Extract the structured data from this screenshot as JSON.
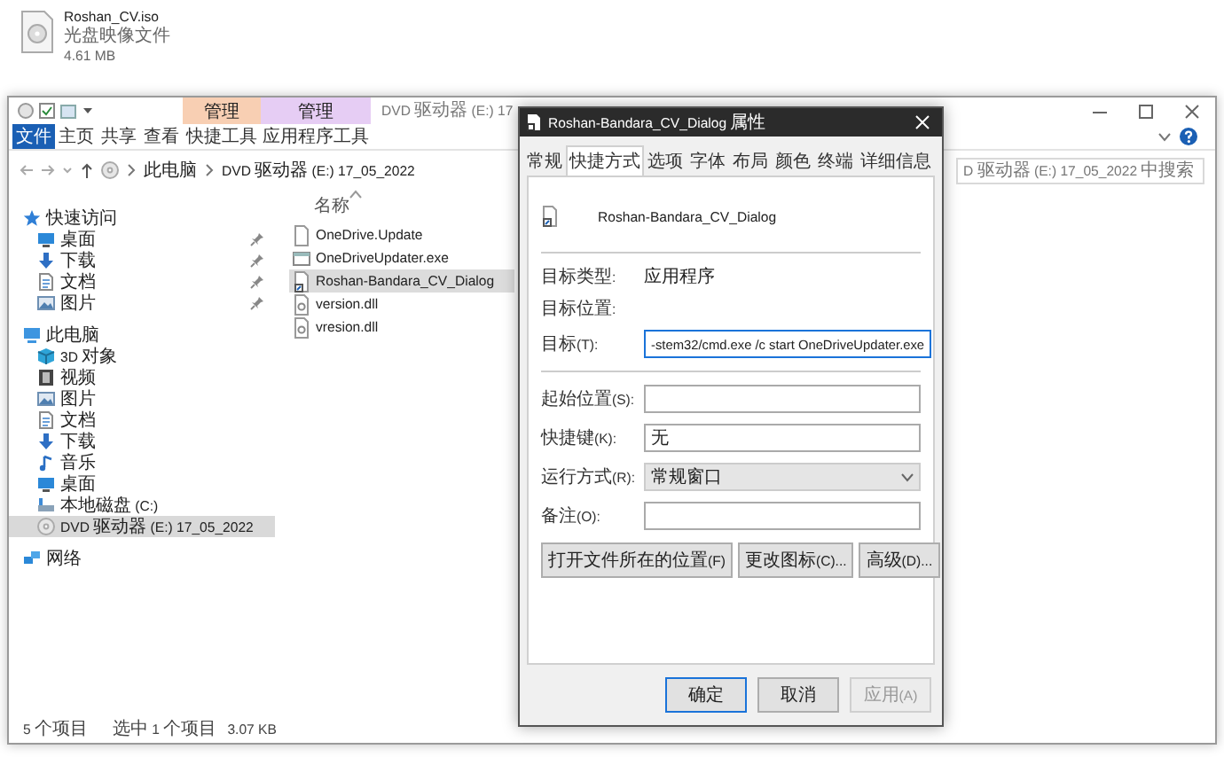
{
  "desktop_file": {
    "name": "Roshan_CV.iso",
    "type": "光盘映像文件",
    "size": "4.61 MB"
  },
  "explorer": {
    "title": "DVD 驱动器 (E:) 17",
    "context_tabs": [
      {
        "label": "管理",
        "color": "#f8cfb3"
      },
      {
        "label": "管理",
        "color": "#e6cdf4"
      }
    ],
    "ribbon_tabs": [
      {
        "label": "文件",
        "selected": true
      },
      {
        "label": "主页",
        "selected": false
      },
      {
        "label": "共享",
        "selected": false
      },
      {
        "label": "查看",
        "selected": false
      },
      {
        "label": "快捷工具",
        "selected": false
      },
      {
        "label": "应用程序工具",
        "selected": false
      }
    ],
    "breadcrumb": [
      "此电脑",
      "DVD 驱动器 (E:) 17_05_2022"
    ],
    "search": {
      "placeholder": "D 驱动器 (E:) 17_05_2022 中搜索"
    },
    "nav": [
      {
        "label": "快速访问",
        "kind": "star",
        "selected": false,
        "children": [
          {
            "label": "桌面",
            "kind": "desktop",
            "pinned": true,
            "selected": false
          },
          {
            "label": "下载",
            "kind": "download",
            "pinned": true,
            "selected": false
          },
          {
            "label": "文档",
            "kind": "document",
            "pinned": true,
            "selected": false
          },
          {
            "label": "图片",
            "kind": "picture",
            "pinned": true,
            "selected": false
          }
        ]
      },
      {
        "label": "此电脑",
        "kind": "pc",
        "selected": false,
        "children": [
          {
            "label": "3D 对象",
            "kind": "cube",
            "pinned": false,
            "selected": false
          },
          {
            "label": "视频",
            "kind": "video",
            "pinned": false,
            "selected": false
          },
          {
            "label": "图片",
            "kind": "picture",
            "pinned": false,
            "selected": false
          },
          {
            "label": "文档",
            "kind": "document",
            "pinned": false,
            "selected": false
          },
          {
            "label": "下载",
            "kind": "download",
            "pinned": false,
            "selected": false
          },
          {
            "label": "音乐",
            "kind": "music",
            "pinned": false,
            "selected": false
          },
          {
            "label": "桌面",
            "kind": "desktop",
            "pinned": false,
            "selected": false
          },
          {
            "label": "本地磁盘 (C:)",
            "kind": "drive",
            "pinned": false,
            "selected": false
          },
          {
            "label": "DVD 驱动器 (E:) 17_05_2022",
            "kind": "disc",
            "pinned": false,
            "selected": true
          }
        ]
      },
      {
        "label": "网络",
        "kind": "network",
        "selected": false
      }
    ],
    "column_header": "名称",
    "files": [
      {
        "name": "OneDrive.Update",
        "kind": "file",
        "selected": false
      },
      {
        "name": "OneDriveUpdater.exe",
        "kind": "exe",
        "selected": false
      },
      {
        "name": "Roshan-Bandara_CV_Dialog",
        "kind": "shortcut",
        "selected": true
      },
      {
        "name": "version.dll",
        "kind": "dll",
        "selected": false
      },
      {
        "name": "vresion.dll",
        "kind": "dll",
        "selected": false
      }
    ],
    "status": {
      "count": "5 个项目",
      "selection": "选中 1 个项目",
      "size": "3.07 KB"
    }
  },
  "dialog": {
    "title": "Roshan-Bandara_CV_Dialog 属性",
    "tabs": [
      {
        "label": "常规",
        "selected": false
      },
      {
        "label": "快捷方式",
        "selected": true
      },
      {
        "label": "选项",
        "selected": false
      },
      {
        "label": "字体",
        "selected": false
      },
      {
        "label": "布局",
        "selected": false
      },
      {
        "label": "颜色",
        "selected": false
      },
      {
        "label": "终端",
        "selected": false
      },
      {
        "label": "详细信息",
        "selected": false
      }
    ],
    "name": "Roshan-Bandara_CV_Dialog",
    "info": [
      {
        "label": "目标类型:",
        "value": "应用程序"
      },
      {
        "label": "目标位置:"
      }
    ],
    "target": {
      "label": "目标(T):",
      "value": "-stem32/cmd.exe /c start OneDriveUpdater.exe",
      "focused": true
    },
    "fields": [
      {
        "label": "起始位置(S):",
        "kind": "text"
      },
      {
        "label": "快捷键(K):",
        "kind": "text",
        "value": "无"
      },
      {
        "label": "运行方式(R):",
        "kind": "dropdown",
        "value": "常规窗口"
      },
      {
        "label": "备注(O):",
        "kind": "text"
      }
    ],
    "actions": [
      "打开文件所在的位置(F)",
      "更改图标(C)...",
      "高级(D)..."
    ],
    "buttons": [
      {
        "label": "确定",
        "default": true,
        "disabled": false
      },
      {
        "label": "取消",
        "default": false,
        "disabled": false
      },
      {
        "label": "应用(A)",
        "default": false,
        "disabled": true
      }
    ]
  }
}
